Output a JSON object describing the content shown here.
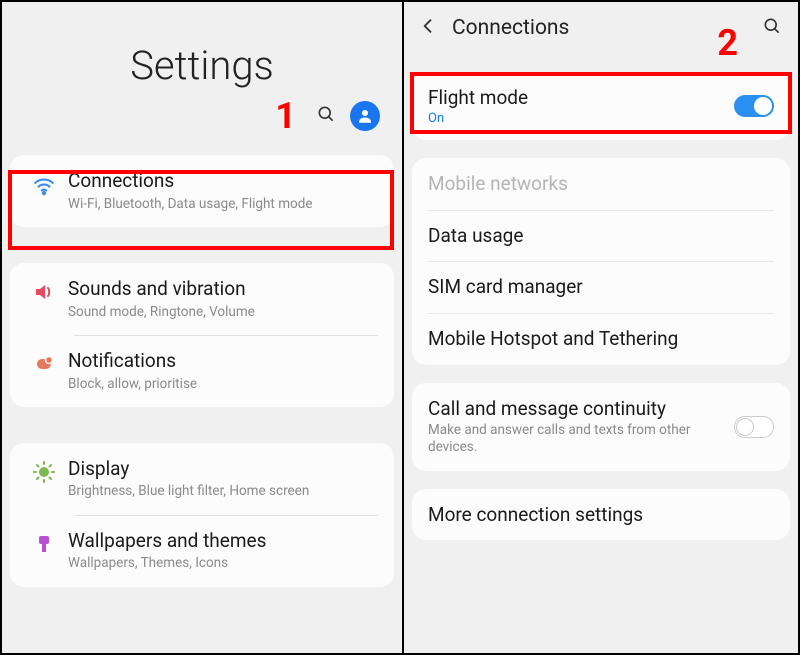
{
  "annotations": {
    "step1": "1",
    "step2": "2"
  },
  "left": {
    "title": "Settings",
    "items": [
      {
        "label": "Connections",
        "desc": "Wi-Fi, Bluetooth, Data usage, Flight mode"
      },
      {
        "label": "Sounds and vibration",
        "desc": "Sound mode, Ringtone, Volume"
      },
      {
        "label": "Notifications",
        "desc": "Block, allow, prioritise"
      },
      {
        "label": "Display",
        "desc": "Brightness, Blue light filter, Home screen"
      },
      {
        "label": "Wallpapers and themes",
        "desc": "Wallpapers, Themes, Icons"
      }
    ]
  },
  "right": {
    "title": "Connections",
    "flight": {
      "label": "Flight mode",
      "status": "On"
    },
    "rows": {
      "mobile_networks": "Mobile networks",
      "data_usage": "Data usage",
      "sim": "SIM card manager",
      "hotspot": "Mobile Hotspot and Tethering",
      "continuity_label": "Call and message continuity",
      "continuity_desc": "Make and answer calls and texts from other devices.",
      "more": "More connection settings"
    }
  }
}
